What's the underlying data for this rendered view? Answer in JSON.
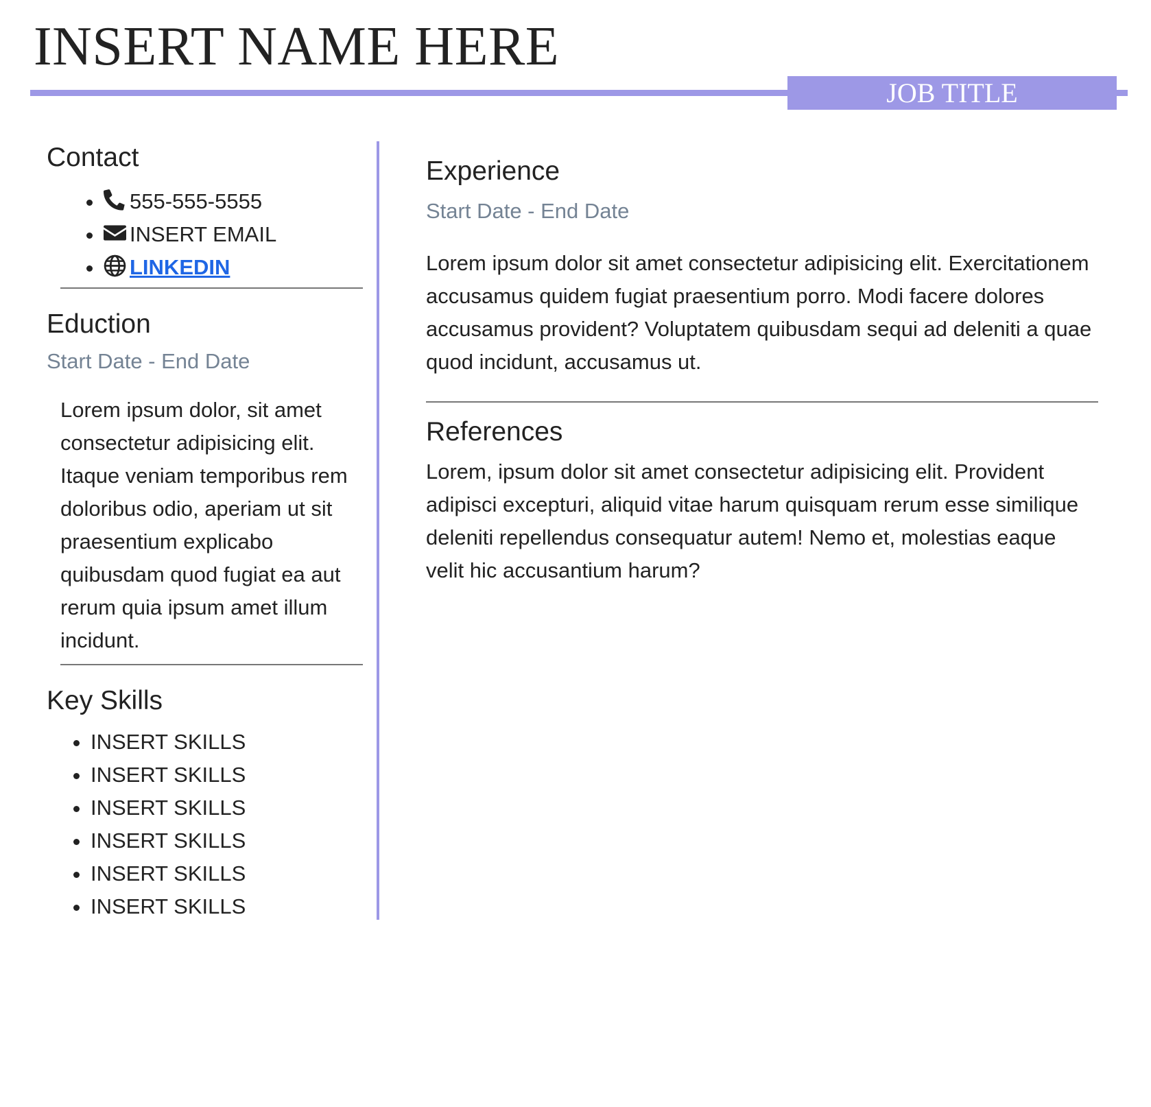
{
  "header": {
    "name": "INSERT NAME HERE",
    "job_title": "JOB TITLE"
  },
  "contact": {
    "heading": "Contact",
    "phone": "555-555-5555",
    "email": "INSERT EMAIL",
    "linkedin": "LINKEDIN"
  },
  "education": {
    "heading": "Eduction",
    "dates": "Start Date - End Date",
    "description": "Lorem ipsum dolor, sit amet consectetur adipisicing elit. Itaque veniam temporibus rem doloribus odio, aperiam ut sit praesentium explicabo quibusdam quod fugiat ea aut rerum quia ipsum amet illum incidunt."
  },
  "skills": {
    "heading": "Key Skills",
    "items": [
      "INSERT SKILLS",
      "INSERT SKILLS",
      "INSERT SKILLS",
      "INSERT SKILLS",
      "INSERT SKILLS",
      "INSERT SKILLS"
    ]
  },
  "experience": {
    "heading": "Experience",
    "dates": "Start Date - End Date",
    "description": "Lorem ipsum dolor sit amet consectetur adipisicing elit. Exercitationem accusamus quidem fugiat praesentium porro. Modi facere dolores accusamus provident? Voluptatem quibusdam sequi ad deleniti a quae quod incidunt, accusamus ut."
  },
  "references": {
    "heading": "References",
    "description": "Lorem, ipsum dolor sit amet consectetur adipisicing elit. Provident adipisci excepturi, aliquid vitae harum quisquam rerum esse similique deleniti repellendus consequatur autem! Nemo et, molestias eaque velit hic accusantium harum?"
  },
  "colors": {
    "accent": "#9d98e6",
    "muted_text": "#748394",
    "link": "#1f66e5"
  },
  "icons": {
    "phone": "phone-icon",
    "email": "envelope-icon",
    "linkedin": "globe-icon"
  }
}
